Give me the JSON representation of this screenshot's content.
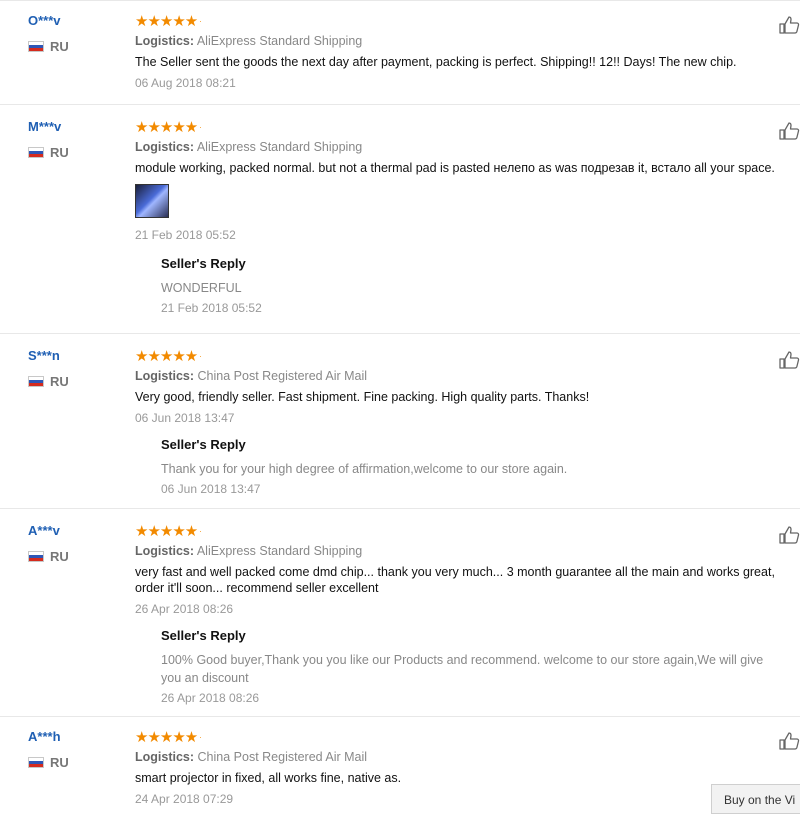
{
  "logistics_label": "Logistics:",
  "seller_reply_label": "Seller's Reply",
  "colors": {
    "star": "#f28a00",
    "username": "#1f5fb3",
    "muted": "#888888"
  },
  "reviews": [
    {
      "user": "O***v",
      "country": "RU",
      "rating": 5,
      "logistics": "AliExpress Standard Shipping",
      "text": "The Seller sent the goods the next day after payment, packing is perfect. Shipping!! 12!! Days! The new chip.",
      "date": "06 Aug 2018 08:21"
    },
    {
      "user": "M***v",
      "country": "RU",
      "rating": 5,
      "logistics": "AliExpress Standard Shipping",
      "text": "module working, packed normal. but not a thermal pad is pasted нелепо as was подрезав it, встало all your space.",
      "date": "21 Feb 2018 05:52",
      "reply": {
        "text": "WONDERFUL",
        "date": "21 Feb 2018 05:52"
      }
    },
    {
      "user": "S***n",
      "country": "RU",
      "rating": 5,
      "logistics": "China Post Registered Air Mail",
      "text": "Very good, friendly seller. Fast shipment. Fine packing. High quality parts. Thanks!",
      "date": "06 Jun 2018 13:47",
      "reply": {
        "text": "Thank you for your high degree of affirmation,welcome to our store again.",
        "date": "06 Jun 2018 13:47"
      }
    },
    {
      "user": "A***v",
      "country": "RU",
      "rating": 5,
      "logistics": "AliExpress Standard Shipping",
      "text": "very fast and well packed come dmd chip... thank you very much... 3 month guarantee all the main and works great, order it'll soon... recommend seller excellent",
      "date": "26 Apr 2018 08:26",
      "reply": {
        "text": "100% Good buyer,Thank you you like our Products and recommend. welcome to our store again,We will give you an discount",
        "date": "26 Apr 2018 08:26"
      }
    },
    {
      "user": "A***h",
      "country": "RU",
      "rating": 5,
      "logistics": "China Post Registered Air Mail",
      "text": "smart projector in fixed, all works fine, native as.",
      "date": "24 Apr 2018 07:29"
    }
  ],
  "view_button_label": "Buy on the Vi"
}
